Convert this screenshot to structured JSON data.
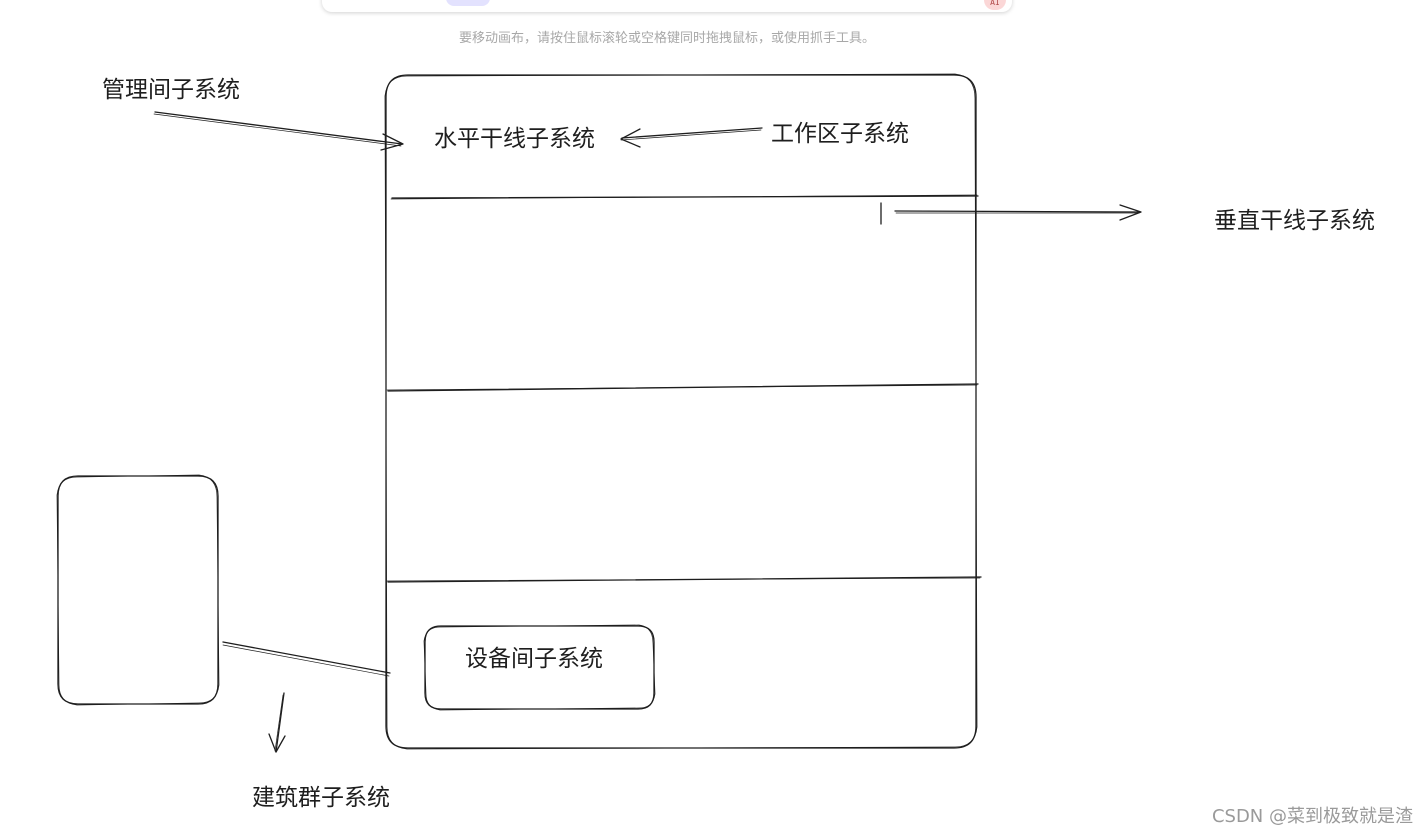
{
  "toolbar": {
    "ai_badge": "AI"
  },
  "hint": "要移动画布，请按住鼠标滚轮或空格键同时拖拽鼠标，或使用抓手工具。",
  "labels": {
    "management": "管理间子系统",
    "horizontal": "水平干线子系统",
    "workarea": "工作区子系统",
    "vertical": "垂直干线子系统",
    "equipment": "设备间子系统",
    "campus": "建筑群子系统"
  },
  "watermark": "CSDN @菜到极致就是渣",
  "colors": {
    "stroke": "#1e1e1e",
    "hint": "#a8a8a8",
    "watermark": "#9a9a9a"
  }
}
